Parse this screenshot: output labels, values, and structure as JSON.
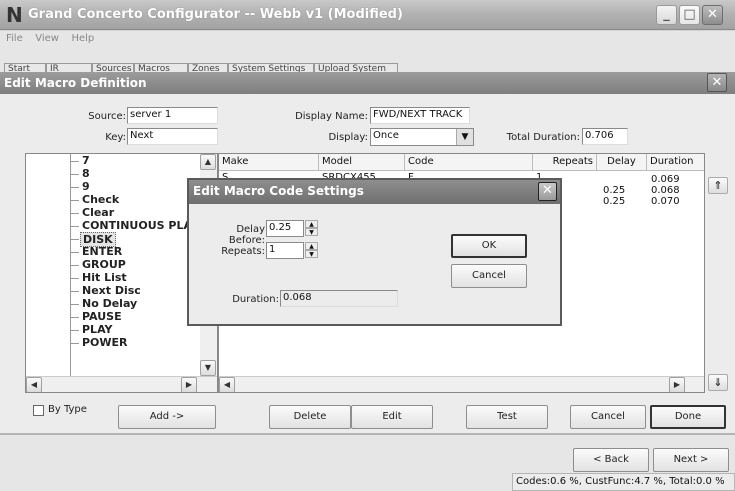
{
  "window": {
    "logo": "N",
    "title": "Grand Concerto Configurator -- Webb v1 (Modified)",
    "min_glyph": "_",
    "max_glyph": "□",
    "close_glyph": "✕"
  },
  "menu": [
    "File",
    "View",
    "Help"
  ],
  "tabs_partial": [
    "Start",
    "IR Library",
    "Sources",
    "Macros",
    "Zones",
    "System Settings",
    "Upload System"
  ],
  "dialog": {
    "title": "Edit Macro Definition",
    "close_glyph": "✕",
    "source_label": "Source:",
    "source_value": "server 1",
    "key_label": "Key:",
    "key_value": "Next",
    "display_name_label": "Display Name:",
    "display_name_value": "FWD/NEXT TRACK",
    "display_label": "Display:",
    "display_value": "Once",
    "total_duration_label": "Total Duration:",
    "total_duration_value": "0.706",
    "keys_list": [
      "7",
      "8",
      "9",
      "Check",
      "Clear",
      "CONTINUOUS PLAY",
      "DISK",
      "ENTER",
      "GROUP",
      "Hit List",
      "Next Disc",
      "No Delay",
      "PAUSE",
      "PLAY",
      "POWER"
    ],
    "selected_key": "DISK",
    "grid_columns": [
      "Make",
      "Model",
      "Code",
      "Repeats",
      "Delay",
      "Duration"
    ],
    "grid_rows": [
      {
        "make": "S...",
        "model": "SRDCX455",
        "code": "F...",
        "repeats": "1",
        "delay": "",
        "duration": "0.069"
      },
      {
        "make": "",
        "model": "",
        "code": "",
        "repeats": "",
        "delay": "0.25",
        "duration": "0.068"
      },
      {
        "make": "",
        "model": "",
        "code": "",
        "repeats": "",
        "delay": "0.25",
        "duration": "0.070"
      }
    ],
    "up_arrow_glyph": "⇑",
    "down_arrow_glyph": "⇓",
    "by_type_label": "By Type",
    "add_button": "Add ->",
    "delete_button": "Delete",
    "edit_button": "Edit",
    "test_button": "Test",
    "cancel_button": "Cancel",
    "done_button": "Done"
  },
  "inner_dialog": {
    "title": "Edit Macro Code Settings",
    "close_glyph": "✕",
    "delay_before_label": "Delay Before:",
    "delay_before_value": "0.25",
    "repeats_label": "Repeats:",
    "repeats_value": "1",
    "duration_label": "Duration:",
    "duration_value": "0.068",
    "ok_button": "OK",
    "cancel_button": "Cancel"
  },
  "wizard": {
    "back_button": "< Back",
    "next_button": "Next >"
  },
  "status": "Codes:0.6 %, CustFunc:4.7 %, Total:0.0 %"
}
